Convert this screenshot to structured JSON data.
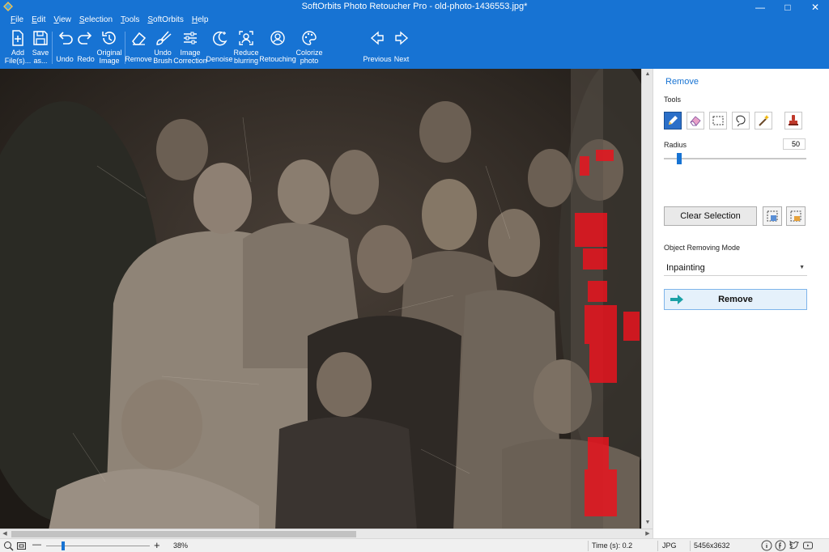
{
  "window": {
    "title": "SoftOrbits Photo Retoucher Pro - old-photo-1436553.jpg*",
    "controls": [
      "minimize-icon",
      "maximize-icon",
      "close-icon"
    ]
  },
  "menu": [
    "File",
    "Edit",
    "View",
    "Selection",
    "Tools",
    "SoftOrbits",
    "Help"
  ],
  "toolbar": {
    "add_files": "Add File(s)...",
    "save_as": "Save as...",
    "undo": "Undo",
    "redo": "Redo",
    "original_image": "Original Image",
    "remove": "Remove",
    "undo_brush": "Undo Brush",
    "image_correction": "Image Correction",
    "denoise": "Denoise",
    "reduce_blurring": "Reduce blurring",
    "retouching": "Retouching",
    "colorize_photo": "Colorize photo",
    "previous": "Previous",
    "next": "Next"
  },
  "panel": {
    "title": "Remove",
    "tools_label": "Tools",
    "tools": [
      "pencil-icon",
      "eraser-icon",
      "rect-select-icon",
      "lasso-icon",
      "magic-wand-icon",
      "stamp-icon"
    ],
    "active_tool": "pencil-icon",
    "radius_label": "Radius",
    "radius_value": "50",
    "clear_selection": "Clear Selection",
    "mode_label": "Object Removing Mode",
    "mode_value": "Inpainting",
    "remove_button": "Remove"
  },
  "status": {
    "zoom": "38%",
    "time": "Time (s): 0.2",
    "format": "JPG",
    "dimensions": "5456x3632"
  },
  "colors": {
    "accent": "#1773d3",
    "selection_mask": "#e8141e"
  }
}
